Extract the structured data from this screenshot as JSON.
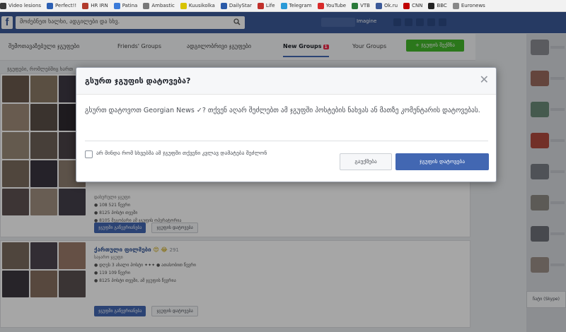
{
  "bookmarks": [
    {
      "label": "Video lesions",
      "color": "#3a3a3a"
    },
    {
      "label": "Perfect!!",
      "color": "#2b5fb3"
    },
    {
      "label": "HR IRN",
      "color": "#b23a2b"
    },
    {
      "label": "Patina",
      "color": "#3b7bd9"
    },
    {
      "label": "Ambastic",
      "color": "#777777"
    },
    {
      "label": "Kuusikolka",
      "color": "#d8c300"
    },
    {
      "label": "DailyStar",
      "color": "#2a5aa8"
    },
    {
      "label": "Life",
      "color": "#c0302b"
    },
    {
      "label": "Telegram",
      "color": "#2a9ad8"
    },
    {
      "label": "YouTube",
      "color": "#d82a2a"
    },
    {
      "label": "VTB",
      "color": "#2a7a3a"
    },
    {
      "label": "Ok.ru",
      "color": "#3b5998"
    },
    {
      "label": "CNN",
      "color": "#c00000"
    },
    {
      "label": "BBC",
      "color": "#222222"
    },
    {
      "label": "Euronews",
      "color": "#888888"
    }
  ],
  "topbar": {
    "logo": "f",
    "search_placeholder": "მოძებნეთ ხალხი, ადგილები და სხვ.",
    "user_name": "Imagine"
  },
  "tabs": [
    {
      "label": "შემოთავაზებული ჯგუფები"
    },
    {
      "label": "Friends' Groups"
    },
    {
      "label": "ადგილობრივი ჯგუფები"
    },
    {
      "label": "New Groups",
      "badge": "1"
    },
    {
      "label": "Your Groups"
    }
  ],
  "create_group_label": "+ ჯგუფის შექმნა",
  "section_label": "ჯგუფები, რომლებშიც ხართ",
  "groups": [
    {
      "title": "",
      "subtitle": "დახურული ჯგუფი",
      "lines": [
        "● 108 521 წევრი",
        "● 8125 პოსტი თვეში",
        "● 8105 მეგობარი ამ ჯგუფის ოპერატორია"
      ],
      "join": "ჯგუფში გაწევრიანება",
      "hide": "ჯგუფის დატოვება"
    },
    {
      "title": "ქართული ფილმები",
      "emoji": "😍 😂",
      "count": "291",
      "subtitle": "საჯარო ჯგუფი",
      "lines": [
        "● დღეს 3 ახალი პოსტი ✦✦✦ ● ათასობით წევრი",
        "● 119 109 წევრი",
        "● 8125 პოსტი თვეში, ამ ჯგუფის წევრია"
      ],
      "join": "ჯგუფში გაწევრიანება",
      "hide": "ჯგუფის დატოვება"
    }
  ],
  "chat_label": "ჩატი (Skype)",
  "modal": {
    "title": "გსურთ ჯგუფის დატოვება?",
    "body": "გსურთ დატოვოთ Georgian News ✓? თქვენ აღარ შეძლებთ ამ ჯგუფში პოსტების ნახვას ან მათზე კომენტარის დატოვებას.",
    "checkbox_label": "არ მინდა რომ სხვებმა ამ ჯგუფში თქვენი კვლავ დამატება შეძლონ",
    "cancel": "გაუქმება",
    "confirm": "ჯგუფის დატოვება",
    "close_icon": "close-icon"
  },
  "colors": {
    "fb_blue": "#3b5998",
    "button_blue": "#4267b2",
    "green": "#42b72a",
    "page_bg": "#e9ebee"
  }
}
